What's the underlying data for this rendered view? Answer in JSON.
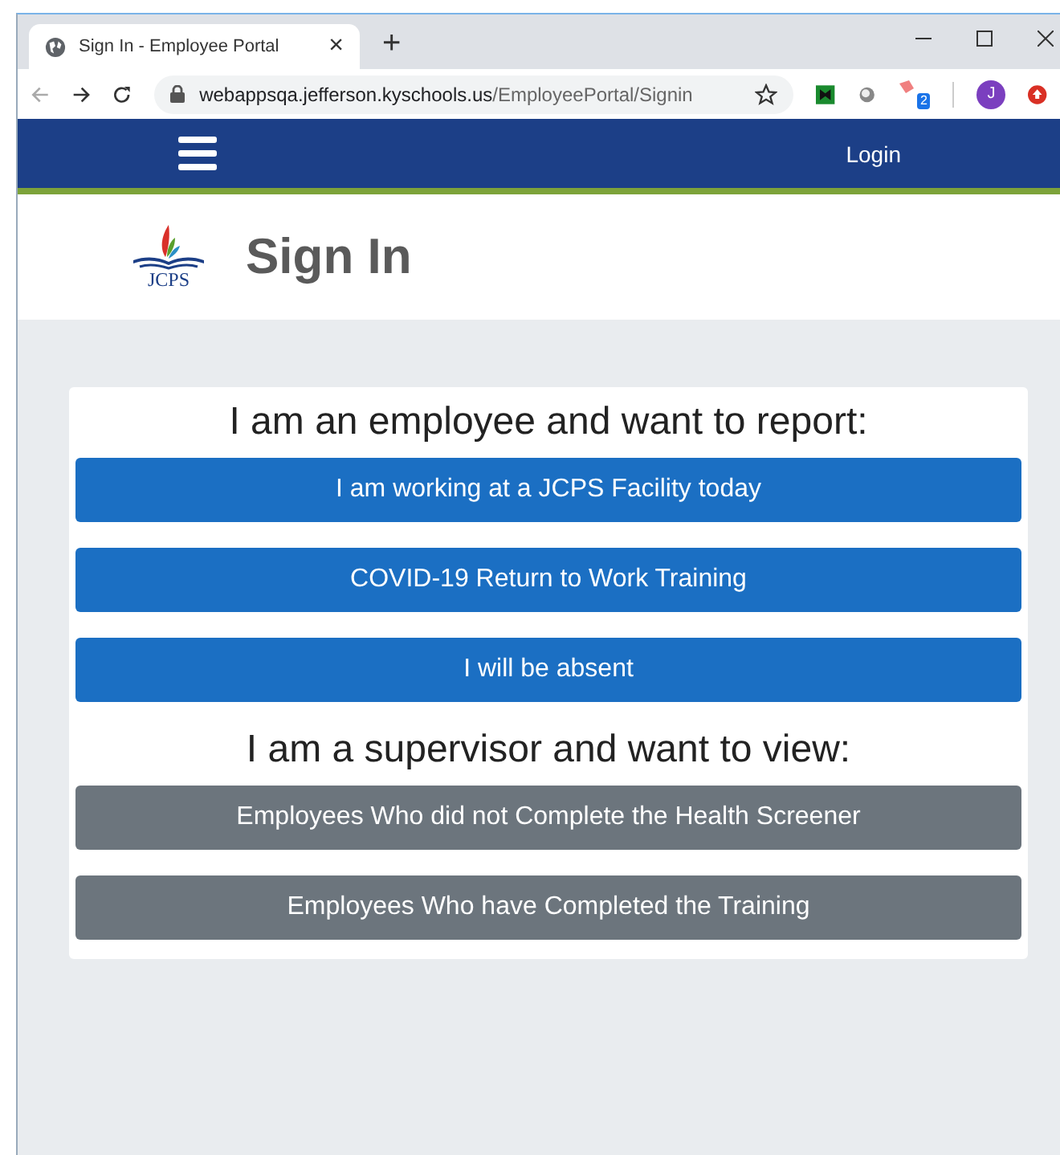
{
  "browser": {
    "tab_title": "Sign In - Employee Portal",
    "tab_close": "×",
    "new_tab": "+",
    "url_host": "webappsqa.jefferson.kyschools.us",
    "url_path": "/EmployeePortal/Signin",
    "extension_badge": "2",
    "avatar_letter": "J"
  },
  "navbar": {
    "login": "Login"
  },
  "header": {
    "logo_text": "JCPS",
    "title": "Sign In"
  },
  "sections": [
    {
      "heading": "I am an employee and want to report:",
      "buttons": [
        {
          "label": "I am working at a JCPS Facility today",
          "kind": "primary"
        },
        {
          "label": "COVID-19 Return to Work Training",
          "kind": "primary"
        },
        {
          "label": "I will be absent",
          "kind": "primary"
        }
      ]
    },
    {
      "heading": "I am a supervisor and want to view:",
      "buttons": [
        {
          "label": "Employees Who did not Complete the Health Screener",
          "kind": "secondary"
        },
        {
          "label": "Employees Who have Completed the Training",
          "kind": "secondary"
        }
      ]
    }
  ]
}
